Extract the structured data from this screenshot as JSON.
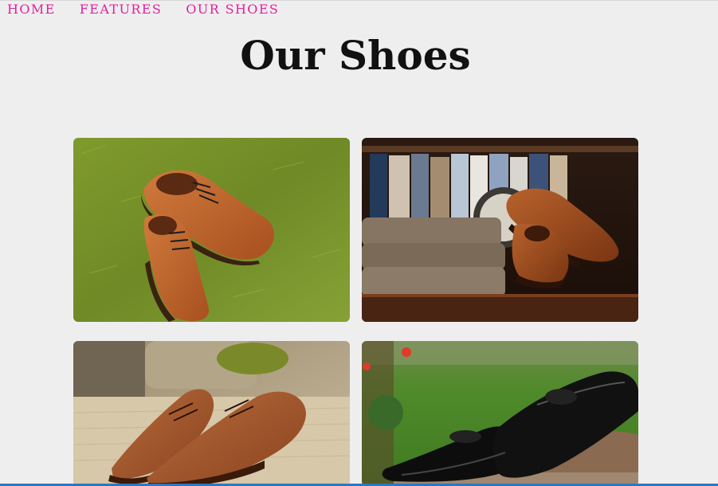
{
  "nav": {
    "items": [
      {
        "label": "HOME"
      },
      {
        "label": "FEATURES"
      },
      {
        "label": "OUR SHOES"
      }
    ]
  },
  "page": {
    "title": "Our Shoes"
  },
  "gallery": {
    "items": [
      {
        "subject": "brown oxford shoes on grass"
      },
      {
        "subject": "brown brogues on shelf with folded trousers"
      },
      {
        "subject": "brown brogues on sofa"
      },
      {
        "subject": "black leather shoes on log outdoors"
      }
    ]
  },
  "colors": {
    "background": "#efeeef",
    "nav_link": "#e0209e",
    "title": "#111111",
    "bottom_bar": "#2b78c2"
  }
}
